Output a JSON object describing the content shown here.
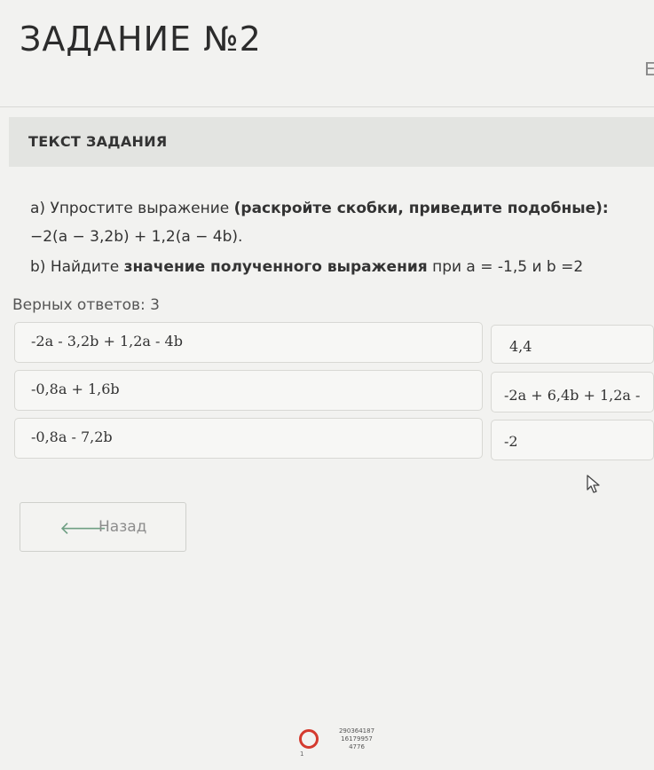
{
  "header": {
    "title": "ЗАДАНИЕ №2",
    "right_letter": "Е"
  },
  "section": {
    "title": "ТЕКСТ ЗАДАНИЯ"
  },
  "task": {
    "line_a_prefix": "a) Упростите выражение ",
    "line_a_bold": "(раскройте скобки, приведите подобные):",
    "line_a_expr": "−2(a − 3,2b) + 1,2(a − 4b).",
    "line_b_prefix": "b) Найдите ",
    "line_b_bold": "значение полученного выражения",
    "line_b_suffix": " при a = -1,5 и b =2"
  },
  "answers": {
    "correct_label": "Верных ответов: 3",
    "left": [
      "-2a - 3,2b + 1,2a - 4b",
      "-0,8a + 1,6b",
      "-0,8a - 7,2b"
    ],
    "right": [
      "4,4",
      "-2a + 6,4b + 1,2a -",
      "-2"
    ]
  },
  "nav": {
    "back_label": "Назад",
    "back_arrow": "🡐"
  },
  "footer": {
    "page_num": "1",
    "info_lines": [
      "290364187",
      "16179957",
      "4776"
    ]
  },
  "colors": {
    "record_circle": "#d43a2e",
    "back_arrow": "#6f9f84"
  }
}
